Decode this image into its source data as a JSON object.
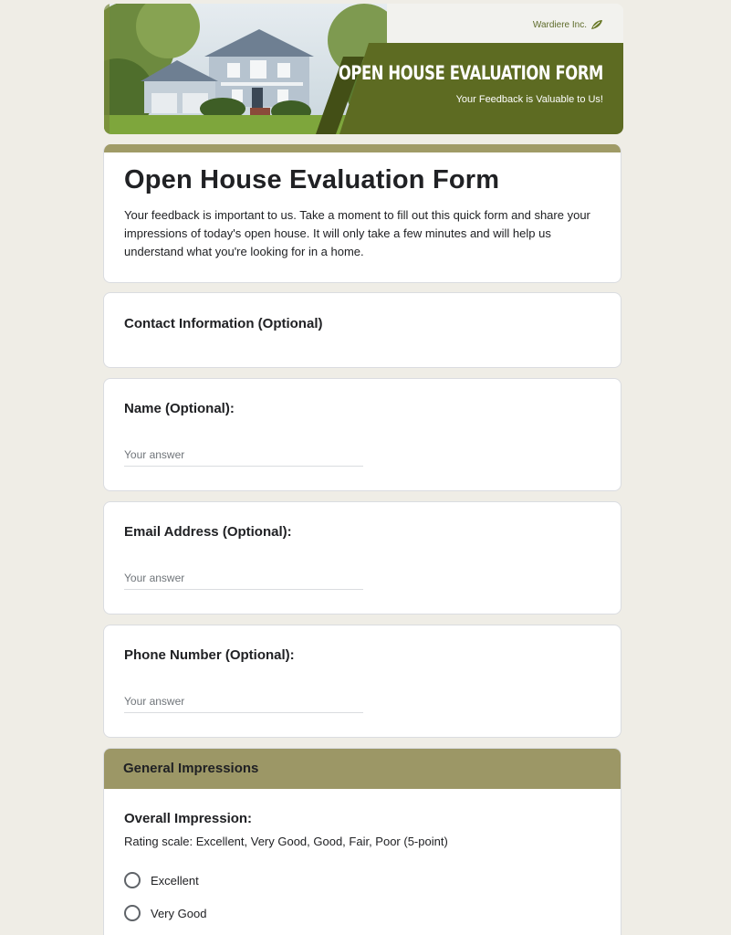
{
  "banner": {
    "brand": "Wardiere Inc.",
    "title": "OPEN HOUSE EVALUATION FORM",
    "subtitle": "Your Feedback is Valuable to Us!",
    "accent_color": "#5d6b22"
  },
  "intro": {
    "title": "Open House Evaluation Form",
    "description": "Your feedback is important to us.  Take a moment to fill out this quick form and share your impressions of today's open house.  It will only take a few minutes and will help us understand what you're looking for in a home.",
    "bar_color": "#a09b67"
  },
  "contact_section": {
    "title": "Contact Information (Optional)"
  },
  "questions": [
    {
      "label": "Name (Optional):",
      "placeholder": "Your answer"
    },
    {
      "label": "Email Address (Optional):",
      "placeholder": "Your answer"
    },
    {
      "label": "Phone Number (Optional):",
      "placeholder": "Your answer"
    }
  ],
  "general": {
    "header": "General Impressions",
    "header_color": "#9c9766",
    "question": "Overall Impression:",
    "scale": "Rating scale: Excellent, Very Good, Good, Fair, Poor (5-point)",
    "options": [
      "Excellent",
      "Very Good"
    ]
  }
}
